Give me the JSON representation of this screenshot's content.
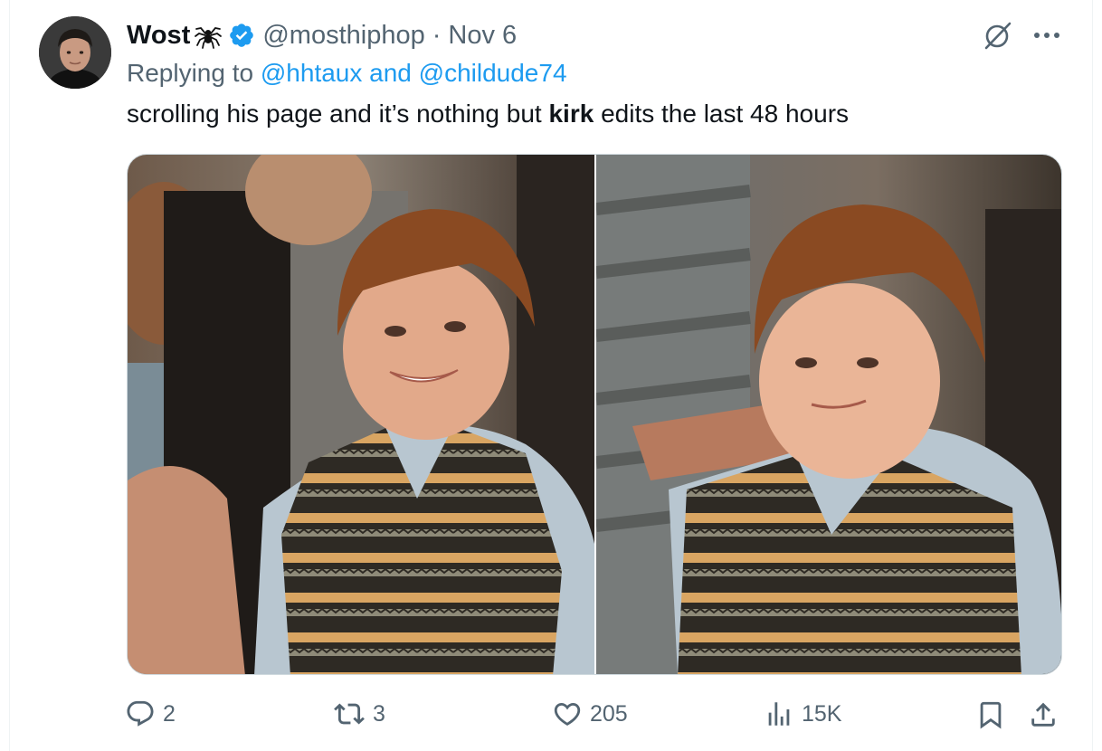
{
  "author": {
    "name": "Wost",
    "emoji_icon": "spider-icon",
    "verified": true,
    "handle": "@mosthiphop",
    "separator": "·",
    "date": "Nov 6"
  },
  "reply": {
    "prefix": "Replying to ",
    "user1": "@hhtaux",
    "joiner": " and ",
    "user2": "@childude74"
  },
  "tweet": {
    "text_before": "scrolling his page and it’s nothing but ",
    "text_bold": "kirk",
    "text_after": " edits the last 48 hours"
  },
  "actions": {
    "replies": "2",
    "reposts": "3",
    "likes": "205",
    "views": "15K"
  },
  "colors": {
    "link": "#1d9bf0",
    "muted": "#536471",
    "text": "#0f1419",
    "verified": "#1d9bf0"
  }
}
